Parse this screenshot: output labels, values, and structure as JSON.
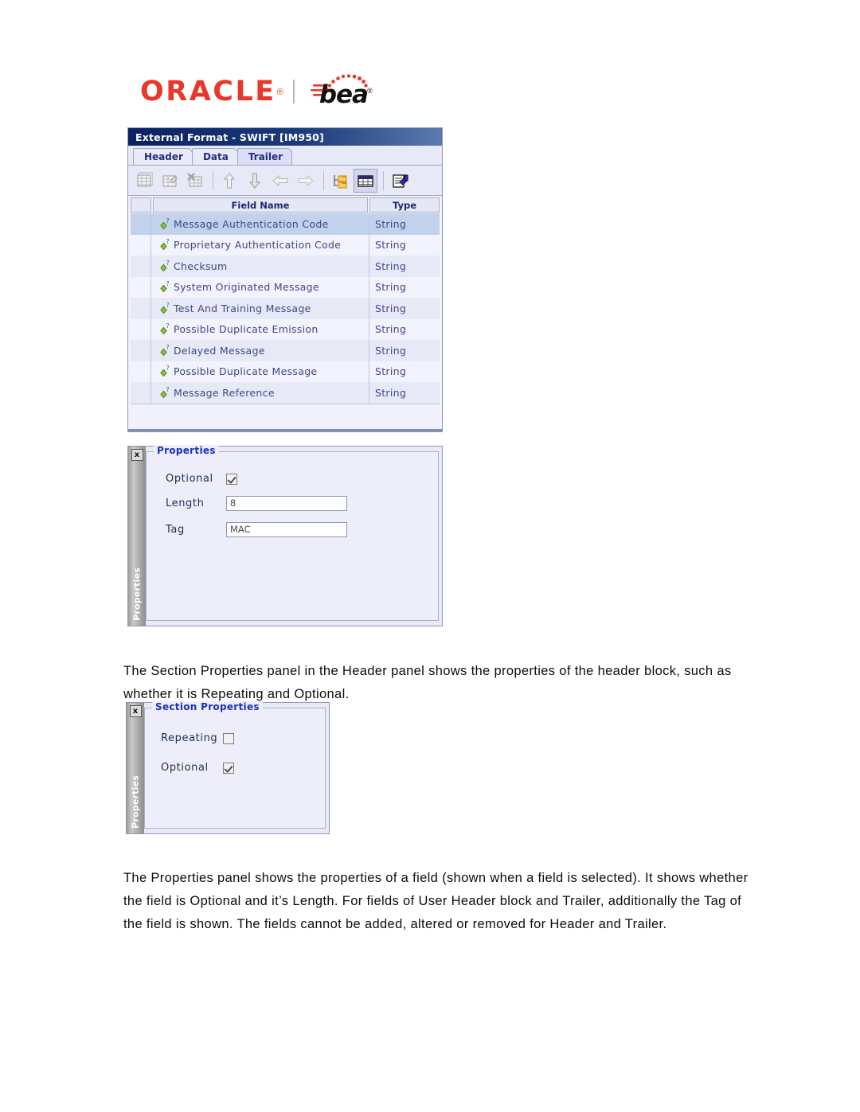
{
  "logo": {
    "oracle_text": "ORACLE",
    "oracle_registered": "®",
    "bea_text": "bea",
    "bea_registered": "®"
  },
  "window": {
    "title": "External Format - SWIFT [IM950]",
    "tabs": [
      {
        "label": "Header",
        "active": false
      },
      {
        "label": "Data",
        "active": false
      },
      {
        "label": "Trailer",
        "active": true
      }
    ],
    "toolbar": [
      {
        "name": "new-table-icon",
        "enabled": false
      },
      {
        "name": "edit-table-icon",
        "enabled": false
      },
      {
        "name": "delete-table-icon",
        "enabled": false
      },
      {
        "name": "move-up-icon",
        "enabled": false
      },
      {
        "name": "move-down-icon",
        "enabled": false
      },
      {
        "name": "move-left-icon",
        "enabled": false
      },
      {
        "name": "move-right-icon",
        "enabled": false
      },
      {
        "name": "tree-view-icon",
        "enabled": true
      },
      {
        "name": "table-view-icon",
        "enabled": true,
        "pressed": true
      },
      {
        "name": "properties-icon",
        "enabled": true
      }
    ],
    "table": {
      "columns": [
        "",
        "Field Name",
        "Type"
      ],
      "rows": [
        {
          "name": "Message Authentication Code",
          "type": "String",
          "selected": true
        },
        {
          "name": "Proprietary Authentication Code",
          "type": "String",
          "selected": false
        },
        {
          "name": "Checksum",
          "type": "String",
          "selected": false
        },
        {
          "name": "System Originated Message",
          "type": "String",
          "selected": false
        },
        {
          "name": "Test And Training Message",
          "type": "String",
          "selected": false
        },
        {
          "name": "Possible Duplicate Emission",
          "type": "String",
          "selected": false
        },
        {
          "name": "Delayed Message",
          "type": "String",
          "selected": false
        },
        {
          "name": "Possible Duplicate Message",
          "type": "String",
          "selected": false
        },
        {
          "name": "Message Reference",
          "type": "String",
          "selected": false
        }
      ]
    }
  },
  "field_properties": {
    "rail_label": "Properties",
    "close_label": "x",
    "legend": "Properties",
    "optional_label": "Optional",
    "optional_checked": true,
    "length_label": "Length",
    "length_value": "8",
    "tag_label": "Tag",
    "tag_value": "MAC"
  },
  "section_properties": {
    "rail_label": "Properties",
    "close_label": "x",
    "legend": "Section Properties",
    "repeating_label": "Repeating",
    "repeating_checked": false,
    "optional_label": "Optional",
    "optional_checked": true
  },
  "paragraphs": {
    "p1": "The Section Properties panel in the Header panel shows the properties of the header block, such as whether it is Repeating and Optional.",
    "p2": "The Properties panel shows the properties of a field (shown when a field is selected). It shows whether the field is Optional and it’s Length. For fields of User Header block and Trailer, additionally the Tag of the field is shown. The fields cannot be added, altered or removed for Header and Trailer."
  },
  "colors": {
    "oracle_red": "#E8382B",
    "title_bar_navy": "#0B2161",
    "legend_blue": "#1d31b4",
    "row_selected": "#C3D2EC",
    "field_text": "#3b4a87"
  }
}
